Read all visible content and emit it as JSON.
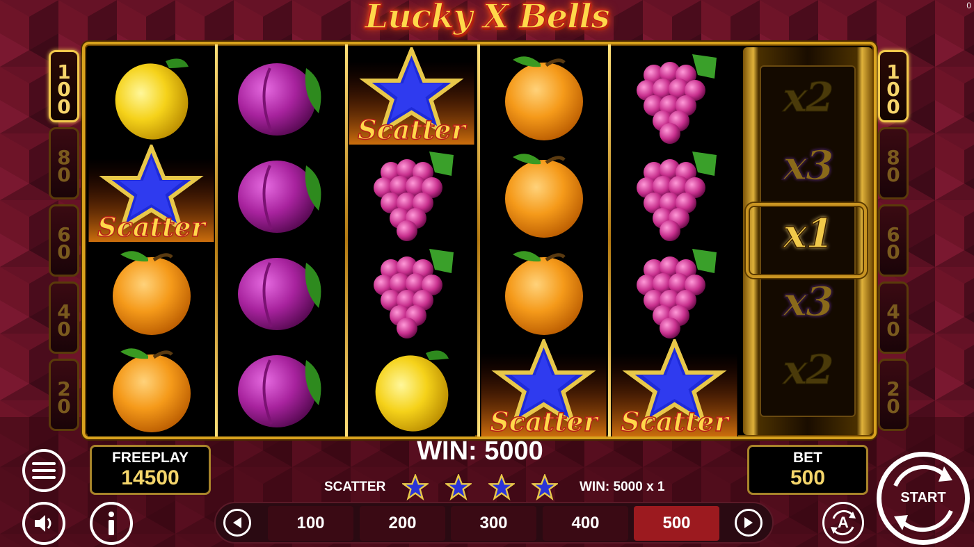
{
  "title": "Lucky X Bells",
  "corner_counter": "0",
  "paylines_left": [
    {
      "label": "100",
      "active": true
    },
    {
      "label": "80",
      "active": false
    },
    {
      "label": "60",
      "active": false
    },
    {
      "label": "40",
      "active": false
    },
    {
      "label": "20",
      "active": false
    }
  ],
  "paylines_right": [
    {
      "label": "100",
      "active": true
    },
    {
      "label": "80",
      "active": false
    },
    {
      "label": "60",
      "active": false
    },
    {
      "label": "40",
      "active": false
    },
    {
      "label": "20",
      "active": false
    }
  ],
  "reels": [
    [
      "lemon",
      "scatter",
      "orange",
      "orange"
    ],
    [
      "plum",
      "plum",
      "plum",
      "plum"
    ],
    [
      "scatter",
      "grapes",
      "grapes",
      "lemon"
    ],
    [
      "orange",
      "orange",
      "orange",
      "scatter"
    ],
    [
      "grapes",
      "grapes",
      "grapes",
      "scatter"
    ]
  ],
  "scatter_text": "Scatter",
  "multiplier_reel": [
    "x2",
    "x3",
    "x1",
    "x3",
    "x2"
  ],
  "multiplier_active": "x1",
  "freeplay": {
    "label": "FREEPLAY",
    "value": "14500"
  },
  "bet": {
    "label": "BET",
    "value": "500"
  },
  "win_text": "WIN: 5000",
  "scatter_line": {
    "label": "SCATTER",
    "star_count": 4,
    "win": "WIN: 5000 x 1"
  },
  "bet_options": [
    "100",
    "200",
    "300",
    "400",
    "500"
  ],
  "selected_bet": "500",
  "start_label": "START",
  "autoplay_label": "A",
  "colors": {
    "gold": "#d8a21e",
    "selected_bet": "#9c1a1f",
    "win_value": "#f5d66b"
  }
}
